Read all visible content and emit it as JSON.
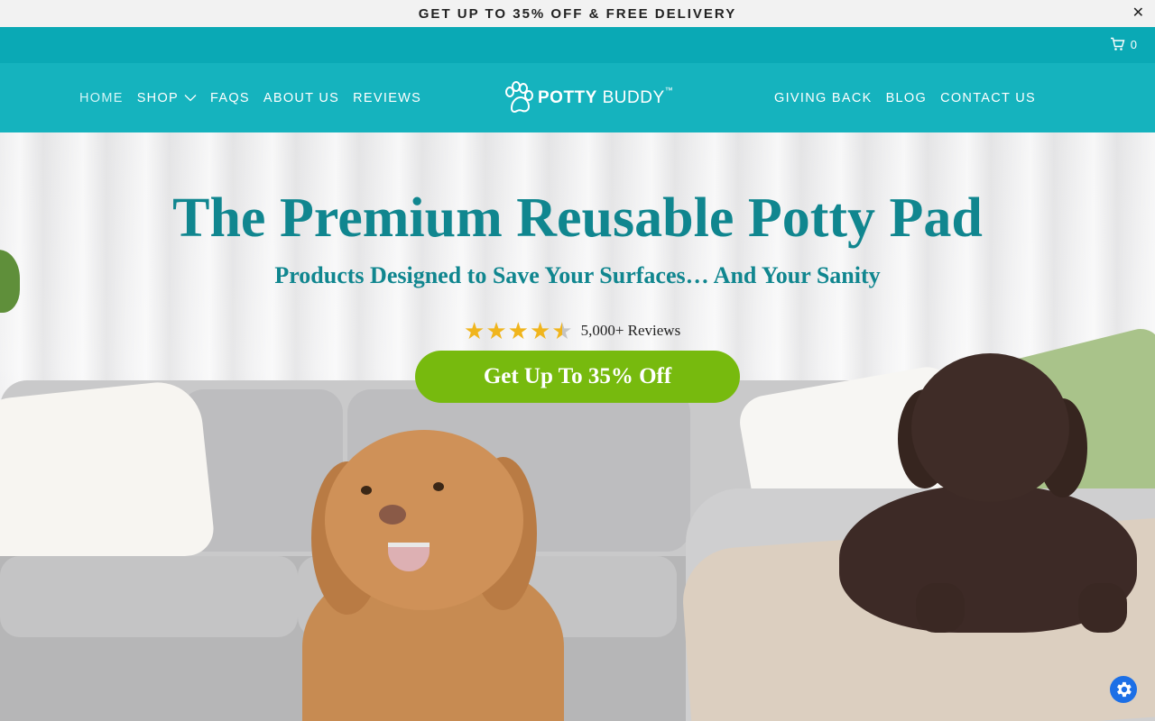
{
  "announcement": {
    "text": "GET UP TO 35% OFF & FREE DELIVERY",
    "close_label": "✕"
  },
  "utility_bar": {
    "cart_count": "0",
    "cart_icon": "cart-icon"
  },
  "header": {
    "nav_left": [
      {
        "label": "HOME",
        "active": true
      },
      {
        "label": "SHOP",
        "has_dropdown": true
      },
      {
        "label": "FAQS"
      },
      {
        "label": "ABOUT US"
      },
      {
        "label": "REVIEWS"
      }
    ],
    "logo": {
      "part1": "POTTY",
      "part2": "BUDDY",
      "mark": "™"
    },
    "nav_right": [
      {
        "label": "GIVING BACK"
      },
      {
        "label": "BLOG"
      },
      {
        "label": "CONTACT US"
      }
    ]
  },
  "hero": {
    "title": "The Premium Reusable Potty Pad",
    "subtitle": "Products Designed to Save Your Surfaces… And Your Sanity",
    "rating": {
      "stars": 4.5,
      "max": 5,
      "reviews_text": "5,000+ Reviews"
    },
    "cta_label": "Get Up To 35% Off"
  },
  "colors": {
    "announcement_bg": "#f2f2f2",
    "utility_bg": "#0aa9b5",
    "header_bg": "#15b3be",
    "title_color": "#10868f",
    "star_color": "#f0b51d",
    "cta_bg": "#77ba0e",
    "accessibility_button": "#1c6fe6"
  },
  "floating": {
    "accessibility_icon": "gear-icon"
  }
}
